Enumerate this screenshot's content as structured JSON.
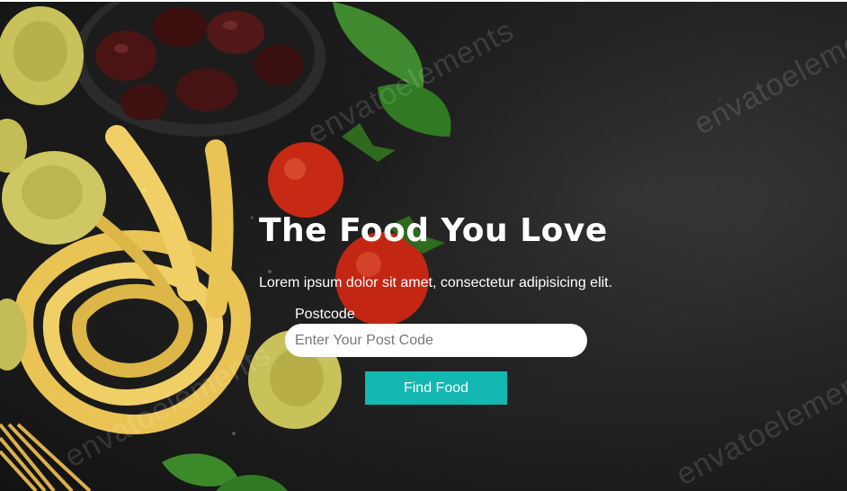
{
  "hero": {
    "title": "The Food You Love",
    "subtitle": "Lorem ipsum dolor sit amet, consectetur adipisicing elit.",
    "watermark_text": "envatoelements"
  },
  "form": {
    "postcode_label": "Postcode",
    "postcode_placeholder": "Enter Your Post Code",
    "postcode_value": "",
    "submit_label": "Find Food"
  },
  "colors": {
    "accent": "#14b8b0",
    "background": "#1f1f1f",
    "text": "#ffffff"
  }
}
